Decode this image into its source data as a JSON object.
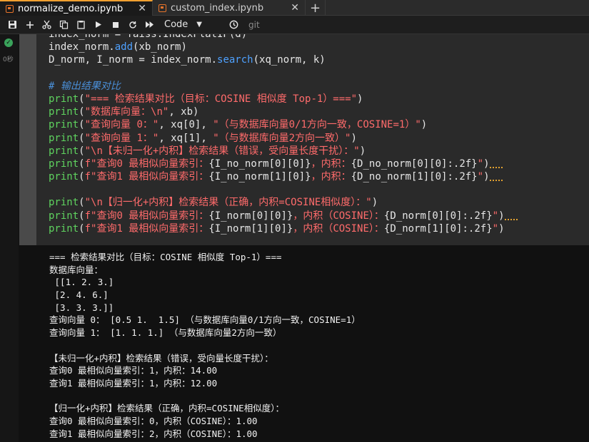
{
  "tabs": [
    {
      "label": "normalize_demo.ipynb",
      "close": "✕"
    },
    {
      "label": "custom_index.ipynb",
      "close": "✕"
    }
  ],
  "tab_add": "+",
  "toolbar": {
    "kernel_mode": "Code",
    "git": "git"
  },
  "cell": {
    "status_time": "0秒",
    "code_lines": [
      [
        {
          "t": "index_norm = faiss.IndexFlatIP(d)",
          "c": "c-id"
        }
      ],
      [
        {
          "t": "index_norm.",
          "c": "c-id"
        },
        {
          "t": "add",
          "c": "c-fn"
        },
        {
          "t": "(xb_norm)",
          "c": "c-id"
        }
      ],
      [
        {
          "t": "D_norm, I_norm = index_norm.",
          "c": "c-id"
        },
        {
          "t": "search",
          "c": "c-fn"
        },
        {
          "t": "(xq_norm, k)",
          "c": "c-id"
        }
      ],
      [],
      [
        {
          "t": "# 输出结果对比",
          "c": "c-com"
        }
      ],
      [
        {
          "t": "print",
          "c": "c-kw"
        },
        {
          "t": "(",
          "c": "c-op"
        },
        {
          "t": "\"=== 检索结果对比（目标：COSINE 相似度 Top-1）===\"",
          "c": "c-str"
        },
        {
          "t": ")",
          "c": "c-op"
        }
      ],
      [
        {
          "t": "print",
          "c": "c-kw"
        },
        {
          "t": "(",
          "c": "c-op"
        },
        {
          "t": "\"数据库向量：\\n\"",
          "c": "c-str"
        },
        {
          "t": ", xb)",
          "c": "c-id"
        }
      ],
      [
        {
          "t": "print",
          "c": "c-kw"
        },
        {
          "t": "(",
          "c": "c-op"
        },
        {
          "t": "\"查询向量 0：\"",
          "c": "c-str"
        },
        {
          "t": ", xq[",
          "c": "c-id"
        },
        {
          "t": "0",
          "c": "c-num"
        },
        {
          "t": "], ",
          "c": "c-id"
        },
        {
          "t": "\"（与数据库向量0/1方向一致，COSINE=1）\"",
          "c": "c-str"
        },
        {
          "t": ")",
          "c": "c-op"
        }
      ],
      [
        {
          "t": "print",
          "c": "c-kw"
        },
        {
          "t": "(",
          "c": "c-op"
        },
        {
          "t": "\"查询向量 1：\"",
          "c": "c-str"
        },
        {
          "t": ", xq[",
          "c": "c-id"
        },
        {
          "t": "1",
          "c": "c-num"
        },
        {
          "t": "], ",
          "c": "c-id"
        },
        {
          "t": "\"（与数据库向量2方向一致）\"",
          "c": "c-str"
        },
        {
          "t": ")",
          "c": "c-op"
        }
      ],
      [
        {
          "t": "print",
          "c": "c-kw"
        },
        {
          "t": "(",
          "c": "c-op"
        },
        {
          "t": "\"\\n【未归一化+内积】检索结果（错误，受向量长度干扰）：\"",
          "c": "c-str"
        },
        {
          "t": ")",
          "c": "c-op"
        }
      ],
      [
        {
          "t": "print",
          "c": "c-kw"
        },
        {
          "t": "(",
          "c": "c-op"
        },
        {
          "t": "f\"查询0 最相似向量索引：",
          "c": "c-str"
        },
        {
          "t": "{I_no_norm[0][0]}",
          "c": "c-brace"
        },
        {
          "t": "，内积：",
          "c": "c-str"
        },
        {
          "t": "{D_no_norm[0][0]:.2f}",
          "c": "c-brace"
        },
        {
          "t": "\"",
          "c": "c-str"
        },
        {
          "t": ")",
          "c": "c-op"
        },
        {
          "sq": true
        }
      ],
      [
        {
          "t": "print",
          "c": "c-kw"
        },
        {
          "t": "(",
          "c": "c-op"
        },
        {
          "t": "f\"查询1 最相似向量索引：",
          "c": "c-str"
        },
        {
          "t": "{I_no_norm[1][0]}",
          "c": "c-brace"
        },
        {
          "t": "，内积：",
          "c": "c-str"
        },
        {
          "t": "{D_no_norm[1][0]:.2f}",
          "c": "c-brace"
        },
        {
          "t": "\"",
          "c": "c-str"
        },
        {
          "t": ")",
          "c": "c-op"
        },
        {
          "sq": true
        }
      ],
      [],
      [
        {
          "t": "print",
          "c": "c-kw"
        },
        {
          "t": "(",
          "c": "c-op"
        },
        {
          "t": "\"\\n【归一化+内积】检索结果（正确，内积=COSINE相似度）：\"",
          "c": "c-str"
        },
        {
          "t": ")",
          "c": "c-op"
        }
      ],
      [
        {
          "t": "print",
          "c": "c-kw"
        },
        {
          "t": "(",
          "c": "c-op"
        },
        {
          "t": "f\"查询0 最相似向量索引：",
          "c": "c-str"
        },
        {
          "t": "{I_norm[0][0]}",
          "c": "c-brace"
        },
        {
          "t": "，内积（COSINE）：",
          "c": "c-str"
        },
        {
          "t": "{D_norm[0][0]:.2f}",
          "c": "c-brace"
        },
        {
          "t": "\"",
          "c": "c-str"
        },
        {
          "t": ")",
          "c": "c-op"
        },
        {
          "sq": true
        }
      ],
      [
        {
          "t": "print",
          "c": "c-kw"
        },
        {
          "t": "(",
          "c": "c-op"
        },
        {
          "t": "f\"查询1 最相似向量索引：",
          "c": "c-str"
        },
        {
          "t": "{I_norm[1][0]}",
          "c": "c-brace"
        },
        {
          "t": "，内积（COSINE）：",
          "c": "c-str"
        },
        {
          "t": "{D_norm[1][0]:.2f}",
          "c": "c-brace"
        },
        {
          "t": "\"",
          "c": "c-str"
        },
        {
          "t": ")",
          "c": "c-op"
        }
      ]
    ],
    "output_lines": [
      "=== 检索结果对比（目标：COSINE 相似度 Top-1）===",
      "数据库向量：",
      " [[1. 2. 3.]",
      " [2. 4. 6.]",
      " [3. 3. 3.]]",
      "查询向量 0： [0.5 1.  1.5] （与数据库向量0/1方向一致，COSINE=1）",
      "查询向量 1： [1. 1. 1.] （与数据库向量2方向一致）",
      "",
      "【未归一化+内积】检索结果（错误，受向量长度干扰）：",
      "查询0 最相似向量索引：1，内积：14.00",
      "查询1 最相似向量索引：1，内积：12.00",
      "",
      "【归一化+内积】检索结果（正确，内积=COSINE相似度）：",
      "查询0 最相似向量索引：0，内积（COSINE）：1.00",
      "查询1 最相似向量索引：2，内积（COSINE）：1.00"
    ]
  }
}
